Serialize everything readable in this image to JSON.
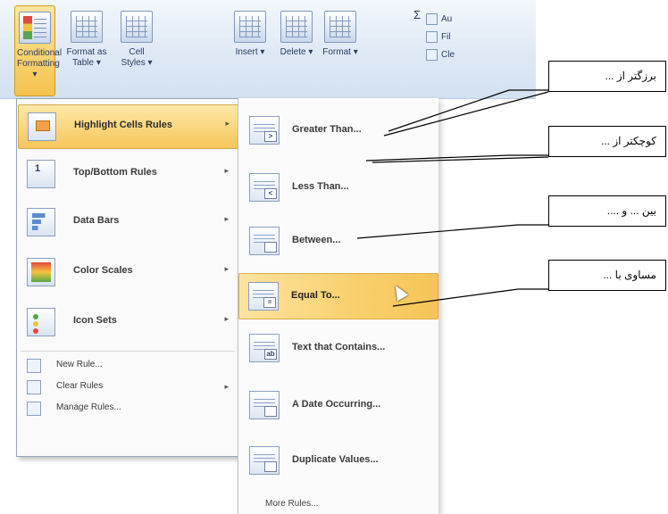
{
  "ribbon": {
    "buttons": [
      {
        "label": "Conditional Formatting ▾",
        "icon": "conditional-formatting-icon"
      },
      {
        "label": "Format as Table ▾",
        "icon": "format-table-icon"
      },
      {
        "label": "Cell Styles ▾",
        "icon": "cell-styles-icon"
      },
      {
        "label": "Insert ▾",
        "icon": "insert-icon"
      },
      {
        "label": "Delete ▾",
        "icon": "delete-icon"
      },
      {
        "label": "Format ▾",
        "icon": "format-icon"
      }
    ],
    "sigma": "Σ",
    "small_tools": [
      "Au",
      "Fil",
      "Cle"
    ]
  },
  "menu": {
    "items": [
      {
        "label": "Highlight Cells Rules",
        "arrow": "▸",
        "icon": "highlight-cells-icon"
      },
      {
        "label": "Top/Bottom Rules",
        "arrow": "▸",
        "icon": "top-bottom-icon"
      },
      {
        "label": "Data Bars",
        "arrow": "▸",
        "icon": "data-bars-icon"
      },
      {
        "label": "Color Scales",
        "arrow": "▸",
        "icon": "color-scales-icon"
      },
      {
        "label": "Icon Sets",
        "arrow": "▸",
        "icon": "icon-sets-icon"
      }
    ],
    "small_items": [
      {
        "label": "New Rule...",
        "arrow": "",
        "icon": "new-rule-icon"
      },
      {
        "label": "Clear Rules",
        "arrow": "▸",
        "icon": "clear-rules-icon"
      },
      {
        "label": "Manage Rules...",
        "arrow": "",
        "icon": "manage-rules-icon"
      }
    ]
  },
  "submenu": {
    "items": [
      {
        "label": "Greater Than...",
        "badge": ">"
      },
      {
        "label": "Less Than...",
        "badge": "<"
      },
      {
        "label": "Between...",
        "badge": ""
      },
      {
        "label": "Equal To...",
        "badge": "="
      },
      {
        "label": "Text that Contains...",
        "badge": "ab"
      },
      {
        "label": "A Date Occurring...",
        "badge": ""
      },
      {
        "label": "Duplicate Values...",
        "badge": ""
      }
    ],
    "more": "More Rules..."
  },
  "callouts": [
    {
      "text": "برزگتر از ..."
    },
    {
      "text": "کوچکتر از ..."
    },
    {
      "text": "بین ... و ...."
    },
    {
      "text": "مساوی با ..."
    }
  ],
  "colors": {
    "highlight": "#f7c658",
    "menu_border": "#9aa6b6"
  }
}
